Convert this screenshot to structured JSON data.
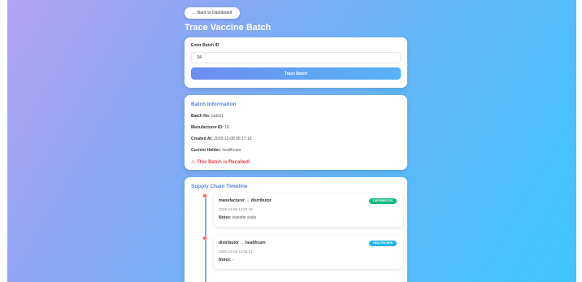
{
  "nav": {
    "back_label": "← Back to Dashboard"
  },
  "page": {
    "title": "Trace Vaccine Batch"
  },
  "search": {
    "label": "Enter Batch ID",
    "value": "34",
    "button_label": "Trace Batch"
  },
  "info": {
    "section_title": "Batch Information",
    "rows": [
      {
        "key": "Batch No:",
        "value": "batch1"
      },
      {
        "key": "Manufacturer ID:",
        "value": "18"
      },
      {
        "key": "Created At:",
        "value": "2025-12-08 06:17:18"
      },
      {
        "key": "Current Holder:",
        "value": "healthcare"
      }
    ],
    "recall_text": "This Batch is Recalled!"
  },
  "timeline": {
    "section_title": "Supply Chain Timeline",
    "events": [
      {
        "title": "manufacturer → distributor",
        "date": "2025-12-08 13:02:16",
        "notes_key": "Notes:",
        "notes_value": "transfer early",
        "badge": "distributor",
        "badge_color": "#10b981"
      },
      {
        "title": "distributor → healthcare",
        "date": "2025-12-08 13:06:21",
        "notes_key": "Notes:",
        "notes_value": "-",
        "badge": "healthcare",
        "badge_color": "#22b8e0"
      }
    ]
  },
  "colors": {
    "accent": "#5b7fd6",
    "recall": "#e0454f",
    "timeline_dot": "#ff6b6b"
  }
}
